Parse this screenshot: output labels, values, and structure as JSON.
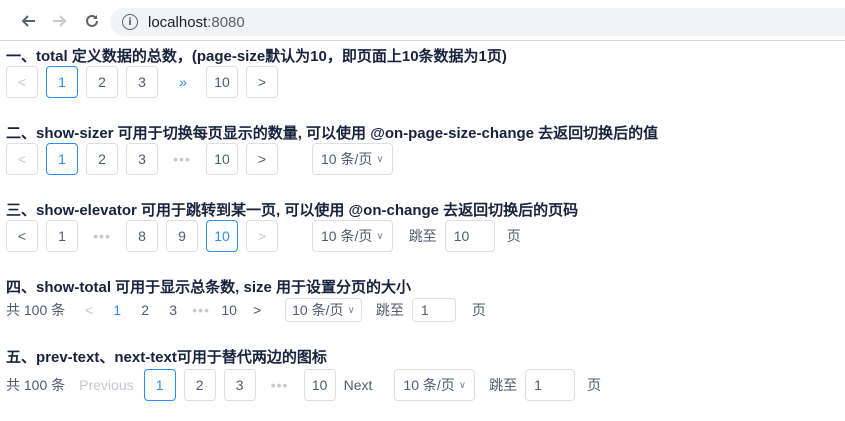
{
  "browser": {
    "url_host": "localhost",
    "url_port": ":8080"
  },
  "sections": [
    {
      "title": "一、total 定义数据的总数，(page-size默认为10，即页面上10条数据为1页)",
      "prev": "<",
      "pages": [
        "1",
        "2",
        "3"
      ],
      "jump": "»",
      "last": "10",
      "next": ">"
    },
    {
      "title": "二、show-sizer 可用于切换每页显示的数量, 可以使用 @on-page-size-change 去返回切换后的值",
      "prev": "<",
      "pages": [
        "1",
        "2",
        "3"
      ],
      "dots": "•••",
      "last": "10",
      "next": ">",
      "sizer": "10 条/页"
    },
    {
      "title": "三、show-elevator 可用于跳转到某一页, 可以使用 @on-change 去返回切换后的页码",
      "prev": "<",
      "first": "1",
      "dots": "•••",
      "pages": [
        "8",
        "9",
        "10"
      ],
      "next": ">",
      "sizer": "10 条/页",
      "elevator_label": "跳至",
      "elevator_value": "10",
      "elevator_suffix": "页"
    },
    {
      "title": "四、show-total 可用于显示总条数, size 用于设置分页的大小",
      "total": "共 100 条",
      "prev": "<",
      "pages": [
        "1",
        "2",
        "3"
      ],
      "dots": "•••",
      "last": "10",
      "next": ">",
      "sizer": "10 条/页",
      "elevator_label": "跳至",
      "elevator_value": "1",
      "elevator_suffix": "页"
    },
    {
      "title": "五、prev-text、next-text可用于替代两边的图标",
      "total": "共 100 条",
      "prev": "Previous",
      "pages": [
        "1",
        "2",
        "3"
      ],
      "dots": "•••",
      "last": "10",
      "next": "Next",
      "sizer": "10 条/页",
      "elevator_label": "跳至",
      "elevator_value": "1",
      "elevator_suffix": "页"
    }
  ],
  "colors": {
    "accent": "#2d8cf0",
    "border": "#dcdee2",
    "disabled": "#c5c8ce"
  }
}
